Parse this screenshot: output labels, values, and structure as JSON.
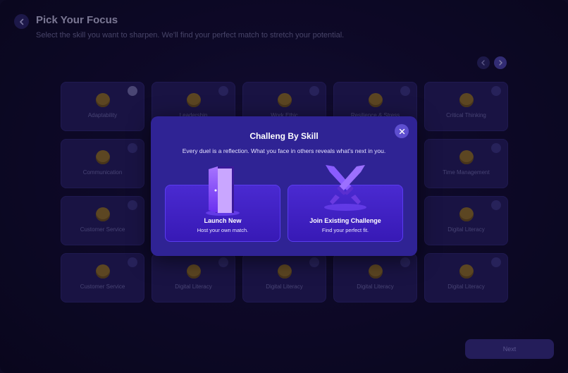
{
  "header": {
    "title": "Pick Your Focus",
    "subtitle": "Select the skill you want to sharpen. We'll find your perfect match to stretch your potential."
  },
  "skills": [
    {
      "label": "Adaptability",
      "selected": true
    },
    {
      "label": "Leadership",
      "selected": false
    },
    {
      "label": "Work Ethic",
      "selected": false
    },
    {
      "label": "Resilience & Stress",
      "selected": false
    },
    {
      "label": "Critical Thinking",
      "selected": false
    },
    {
      "label": "Communication",
      "selected": false
    },
    {
      "label": "",
      "selected": false
    },
    {
      "label": "",
      "selected": false
    },
    {
      "label": "",
      "selected": false
    },
    {
      "label": "Time Management",
      "selected": false
    },
    {
      "label": "Customer Service",
      "selected": false
    },
    {
      "label": "",
      "selected": false
    },
    {
      "label": "",
      "selected": false
    },
    {
      "label": "",
      "selected": false
    },
    {
      "label": "Digital Literacy",
      "selected": false
    },
    {
      "label": "Customer Service",
      "selected": false
    },
    {
      "label": "Digital Literacy",
      "selected": false
    },
    {
      "label": "Digital Literacy",
      "selected": false
    },
    {
      "label": "Digital Literacy",
      "selected": false
    },
    {
      "label": "Digital Literacy",
      "selected": false
    }
  ],
  "modal": {
    "title": "Challeng By Skill",
    "description": "Every duel is a reflection. What you face in others reveals what’s next in you.",
    "options": {
      "launch": {
        "title": "Launch New",
        "subtitle": "Host your own match."
      },
      "join": {
        "title": "Join Existing Challenge",
        "subtitle": "Find your perfect fit."
      }
    }
  },
  "footer": {
    "next_label": "Next"
  },
  "colors": {
    "background": "#0d0a24",
    "modal": "#2f2394",
    "option": "#4a2ad1",
    "card": "#241c5c"
  }
}
